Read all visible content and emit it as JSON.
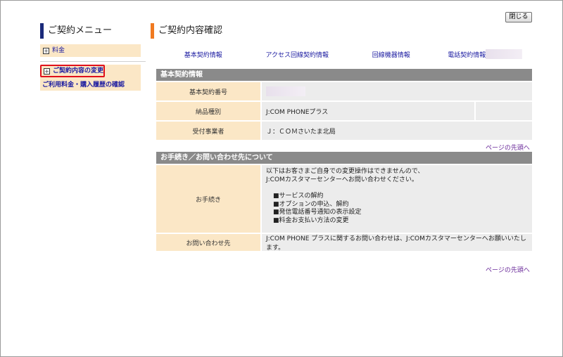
{
  "window": {
    "close_label": "閉じる"
  },
  "sidebar": {
    "title": "ご契約メニュー",
    "items": [
      {
        "label": "料金"
      },
      {
        "label": "ご契約内容の変更"
      }
    ],
    "link_usage": "ご利用料金・購入履歴の確認"
  },
  "main": {
    "title": "ご契約内容確認",
    "tabs": [
      {
        "label": "基本契約情報"
      },
      {
        "label": "アクセス回線契約情報"
      },
      {
        "label": "回線機器情報"
      },
      {
        "label": "電話契約情報"
      }
    ],
    "basic": {
      "heading": "基本契約情報",
      "rows": [
        {
          "label": "基本契約番号",
          "value": ""
        },
        {
          "label": "納品種別",
          "value": "J:COM PHONEプラス"
        },
        {
          "label": "受付事業者",
          "value": "Ｊ：ＣＯＭさいたま北局"
        }
      ]
    },
    "page_top_1": "ページの先頭へ",
    "procedures": {
      "heading": "お手続き／お問い合わせ先について",
      "proc_label": "お手続き",
      "proc_lines": [
        "以下はお客さまご自身での変更操作はできませんので、",
        "J:COMカスタマーセンターへお問い合わせください。"
      ],
      "proc_items": [
        "■サービスの解約",
        "■オプションの申込、解約",
        "■発信電話番号通知の表示設定",
        "■料金お支払い方法の変更"
      ],
      "contact_label": "お問い合わせ先",
      "contact_value": "J:COM PHONE プラスに関するお問い合わせは、J:COMカスタマーセンターへお願いいたします。"
    },
    "page_top_2": "ページの先頭へ"
  }
}
